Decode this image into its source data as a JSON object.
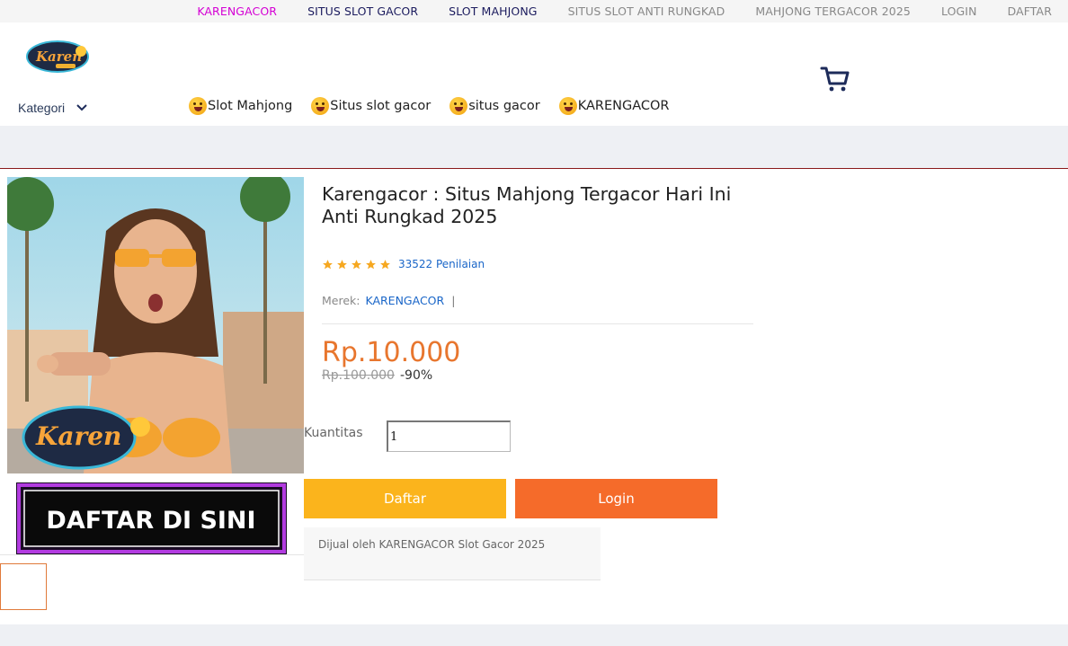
{
  "topnav": {
    "items": [
      "KARENGACOR",
      "SITUS SLOT GACOR",
      "SLOT MAHJONG",
      "SITUS SLOT ANTI RUNGKAD",
      "MAHJONG TERGACOR 2025",
      "LOGIN",
      "DAFTAR"
    ]
  },
  "header": {
    "kategori_label": "Kategori",
    "categories": [
      "Slot Mahjong",
      "Situs slot gacor",
      "situs gacor",
      "KARENGACOR"
    ]
  },
  "product": {
    "title": "Karengacor : Situs Mahjong Tergacor Hari Ini Anti Rungkad 2025",
    "rating_stars": 5,
    "rating_count": "33522 Penilaian",
    "merek_label": "Merek:",
    "merek_value": "KARENGACOR",
    "merek_sep": "|",
    "price": "Rp.10.000",
    "old_price": "Rp.100.000",
    "discount": "-90%",
    "quantity_label": "Kuantitas",
    "quantity_value": "1",
    "btn_daftar": "Daftar",
    "btn_login": "Login",
    "seller": "Dijual oleh KARENGACOR Slot Gacor 2025"
  },
  "banner": {
    "text": "DAFTAR DI SINI"
  },
  "logo": {
    "text": "Karen"
  },
  "colors": {
    "accent_orange": "#f56b2a",
    "accent_yellow": "#fbb41c",
    "price": "#e8762e",
    "link": "#1a66c8",
    "topnav_active": "#d400d4"
  }
}
